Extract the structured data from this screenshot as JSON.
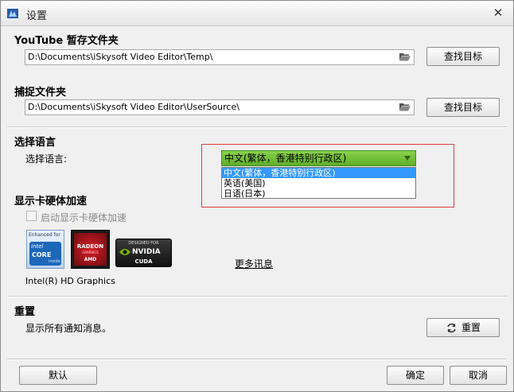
{
  "window": {
    "title": "设置",
    "close_glyph": "✕"
  },
  "youtube": {
    "section_title": "YouTube 暂存文件夹",
    "path": "D:\\Documents\\iSkysoft Video Editor\\Temp\\",
    "browse_label": "查找目标"
  },
  "capture": {
    "section_title": "捕捉文件夹",
    "path": "D:\\Documents\\iSkysoft Video Editor\\UserSource\\",
    "browse_label": "查找目标"
  },
  "language": {
    "section_title": "选择语言",
    "field_label": "选择语言:",
    "selected": "中文(繁体，香港特别行政区)",
    "options": [
      "中文(繁体，香港特别行政区)",
      "英语(美国)",
      "日语(日本)"
    ]
  },
  "gpu": {
    "section_title": "显示卡硬体加速",
    "checkbox_label": "启动显示卡硬体加速",
    "intel_badge": {
      "top": "Enhanced for",
      "brand": "intel",
      "line1": "CORE",
      "line2": "inside"
    },
    "amd_badge": {
      "brand": "RADEON",
      "sub": "GRAPHICS",
      "vendor": "AMD"
    },
    "nvidia_badge": {
      "top": "DESIGNED FOR",
      "brand": "NVIDIA",
      "sub": "CUDA"
    },
    "more_info": "更多讯息",
    "device": "Intel(R) HD Graphics"
  },
  "reset": {
    "section_title": "重置",
    "description": "显示所有通知消息。",
    "button_label": "重置"
  },
  "footer": {
    "default_label": "默认",
    "ok_label": "确定",
    "cancel_label": "取消"
  },
  "colors": {
    "combo_green": "#6cbf35",
    "selection_blue": "#3399ff",
    "highlight_red": "#e0403b"
  }
}
